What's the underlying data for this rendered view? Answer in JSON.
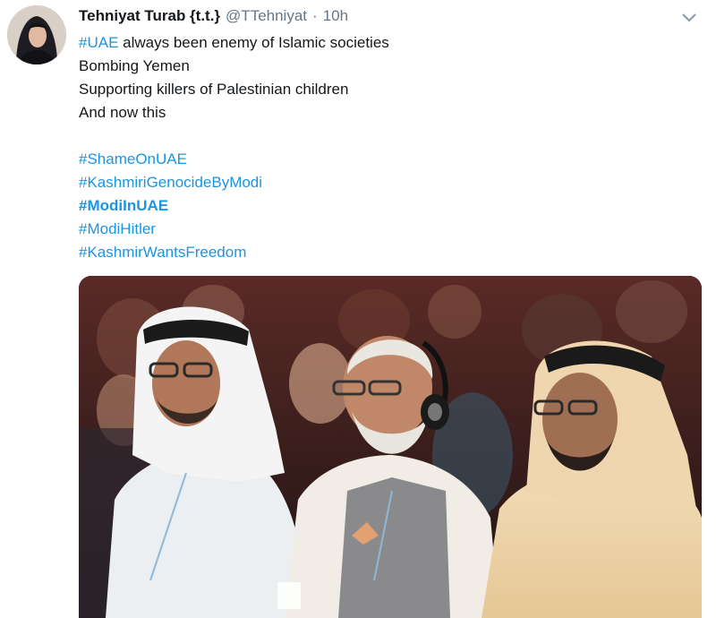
{
  "tweet": {
    "author_name": "Tehniyat Turab {t.t.}",
    "handle": "@TTehniyat",
    "separator": "·",
    "time": "10h",
    "avatar_icon": "user-avatar",
    "menu_icon": "chevron-down-icon",
    "text_lines": [
      {
        "tag": "#UAE",
        "rest": " always been enemy of Islamic societies"
      },
      {
        "text": "Bombing Yemen"
      },
      {
        "text": "Supporting killers of Palestinian children"
      },
      {
        "text": "And now this"
      }
    ],
    "hashtags": [
      "#ShameOnUAE",
      "#KashmiriGenocideByModi",
      "#ModiInUAE",
      "#ModiHitler",
      "#KashmirWantsFreedom"
    ],
    "bold_hashtag": "#ModiInUAE",
    "media": {
      "type": "photo"
    }
  },
  "colors": {
    "link": "#1b95e0",
    "text": "#14171a",
    "muted": "#657786"
  }
}
